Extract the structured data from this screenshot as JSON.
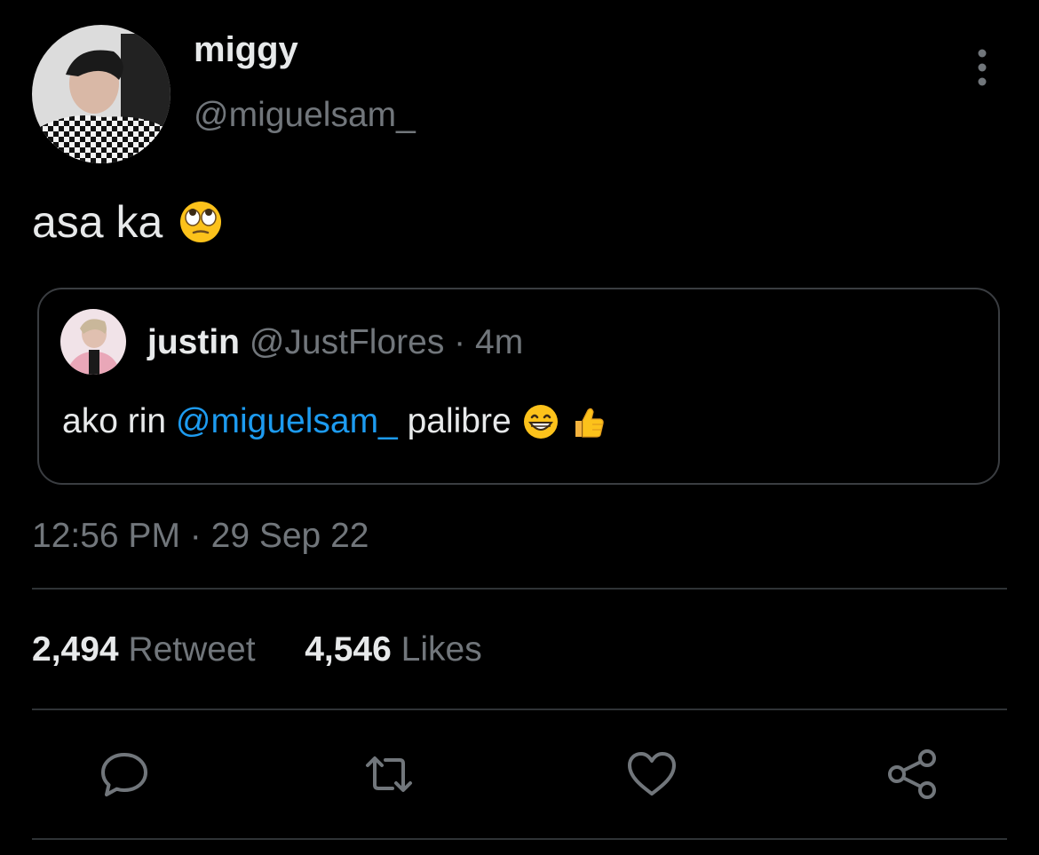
{
  "author": {
    "display_name": "miggy",
    "handle": "@miguelsam_"
  },
  "tweet": {
    "text": "asa ka",
    "emoji": "face-with-rolling-eyes-emoji"
  },
  "quote": {
    "display_name": "justin",
    "handle": "@JustFlores",
    "separator": "·",
    "time": "4m",
    "text_before": "ako rin",
    "mention": "@miguelsam_",
    "text_after": "palibre",
    "emojis": [
      "grinning-face-emoji",
      "thumbs-up-emoji"
    ]
  },
  "timestamp": {
    "time": "12:56 PM",
    "separator": "·",
    "date": "29 Sep 22"
  },
  "stats": {
    "retweets_count": "2,494",
    "retweets_label": "Retweet",
    "likes_count": "4,546",
    "likes_label": "Likes"
  },
  "actions": [
    "reply-icon",
    "retweet-icon",
    "like-icon",
    "share-icon"
  ],
  "colors": {
    "background": "#000000",
    "text": "#e7e9ea",
    "secondary_text": "#71767b",
    "link": "#1d9bf0",
    "border": "#2f3336"
  }
}
